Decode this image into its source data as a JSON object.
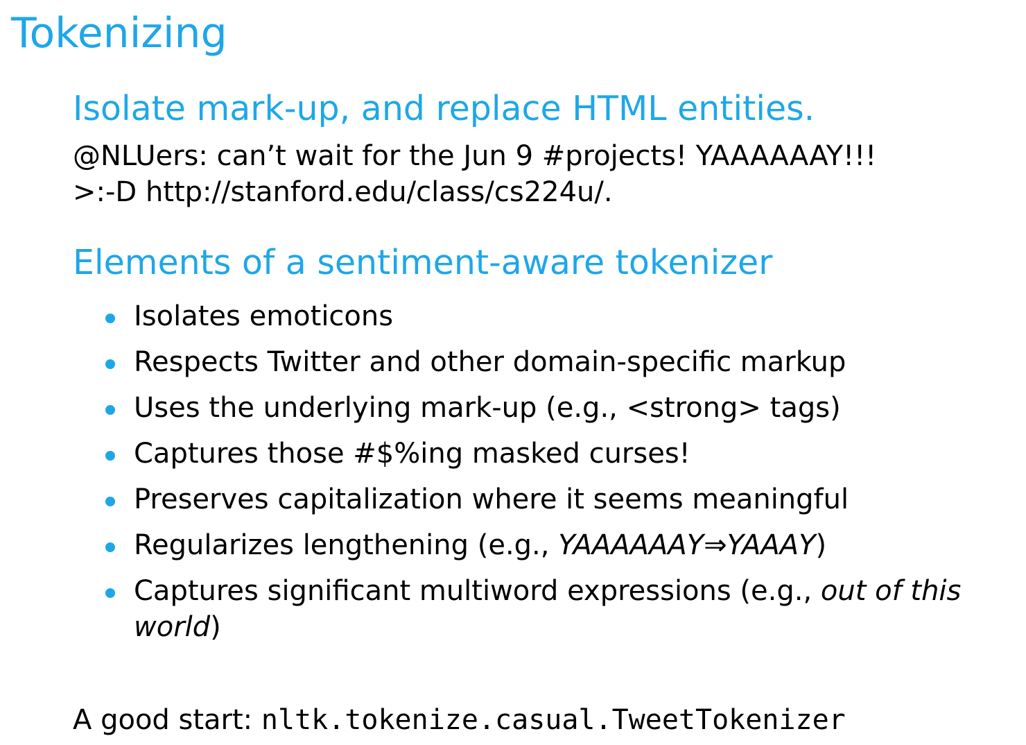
{
  "title": "Tokenizing",
  "section1": {
    "heading": "Isolate mark-up, and replace HTML entities.",
    "example_line1": "@NLUers: can’t wait for the Jun 9 #projects! YAAAAAAY!!!",
    "example_line2": ">:-D http://stanford.edu/class/cs224u/."
  },
  "section2": {
    "heading": "Elements of a sentiment-aware tokenizer",
    "items": [
      {
        "text": "Isolates emoticons"
      },
      {
        "text": "Respects Twitter and other domain-specific markup"
      },
      {
        "text": "Uses the underlying mark-up (e.g., <strong> tags)"
      },
      {
        "text": "Captures those #$%ing masked curses!"
      },
      {
        "text": "Preserves capitalization where it seems meaningful"
      },
      {
        "prefix": "Regularizes lengthening (e.g., ",
        "italic": "YAAAAAAY⇒YAAAY",
        "suffix": ")"
      },
      {
        "prefix": "Captures significant multiword expressions (e.g., ",
        "italic": "out of this world",
        "suffix": ")"
      }
    ]
  },
  "footer": {
    "label": "A good start: ",
    "code": "nltk.tokenize.casual.TweetTokenizer"
  },
  "colors": {
    "accent": "#1ea7e8",
    "text": "#000000"
  }
}
